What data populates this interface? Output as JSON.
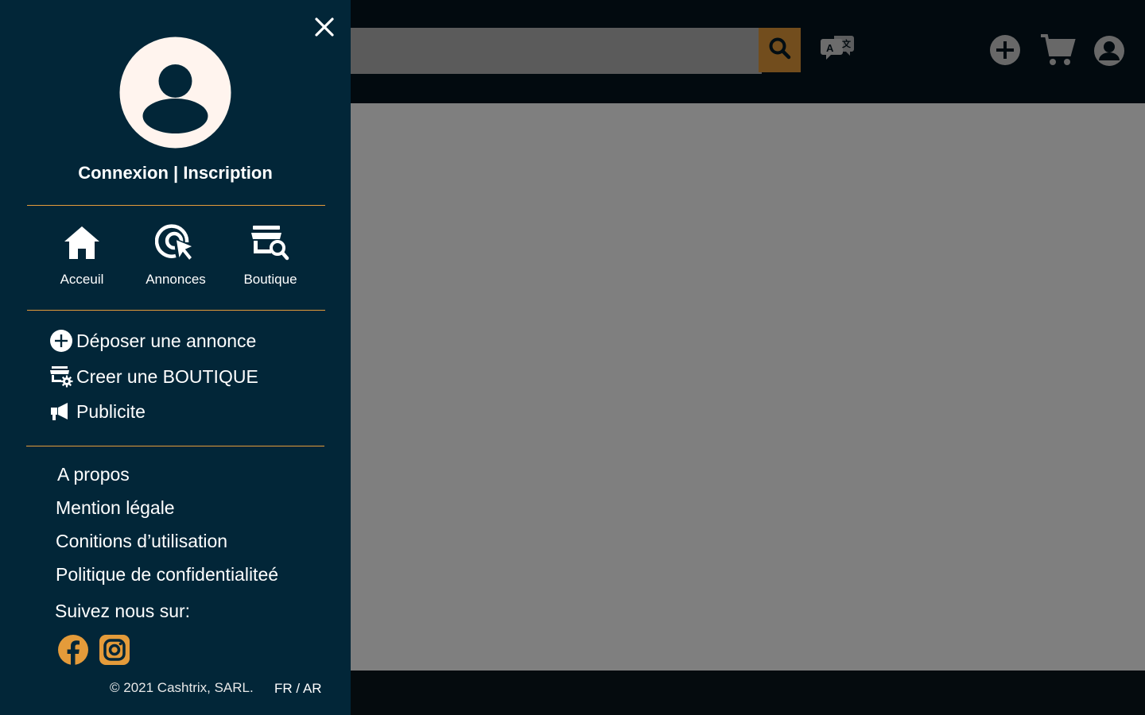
{
  "drawer": {
    "auth": {
      "login": "Connexion",
      "separator": "|",
      "register": "Inscription"
    },
    "nav": [
      {
        "label": "Acceuil",
        "icon": "home-icon"
      },
      {
        "label": "Annonces",
        "icon": "cursor-click-icon"
      },
      {
        "label": "Boutique",
        "icon": "shop-search-icon"
      }
    ],
    "actions": [
      {
        "label": "Déposer une annonce",
        "icon": "plus-circle-icon"
      },
      {
        "label": "Creer une BOUTIQUE",
        "icon": "shop-settings-icon"
      },
      {
        "label": "Publicite",
        "icon": "megaphone-icon"
      }
    ],
    "links": [
      {
        "label": "A propos"
      },
      {
        "label": "Mention légale"
      },
      {
        "label": "Conitions d’utilisation"
      },
      {
        "label": "Politique de confidentialiteé"
      }
    ],
    "follow_label": "Suivez nous sur:",
    "social": [
      "facebook-icon",
      "instagram-icon"
    ],
    "copyright": "© 2021 Cashtrix, SARL.",
    "lang": {
      "fr": "FR",
      "sep": "/",
      "ar": "AR"
    }
  },
  "header": {
    "search": {
      "placeholder": ""
    },
    "icons": [
      "search-icon",
      "translate-icon",
      "add-circle-icon",
      "cart-icon",
      "user-account-icon"
    ]
  },
  "colors": {
    "drawer_bg": "#022638",
    "accent": "#e49b3a",
    "header_bg": "#04151f",
    "avatar_fill": "#fff4ee",
    "overlay": "rgba(0,0,0,0.5)"
  }
}
